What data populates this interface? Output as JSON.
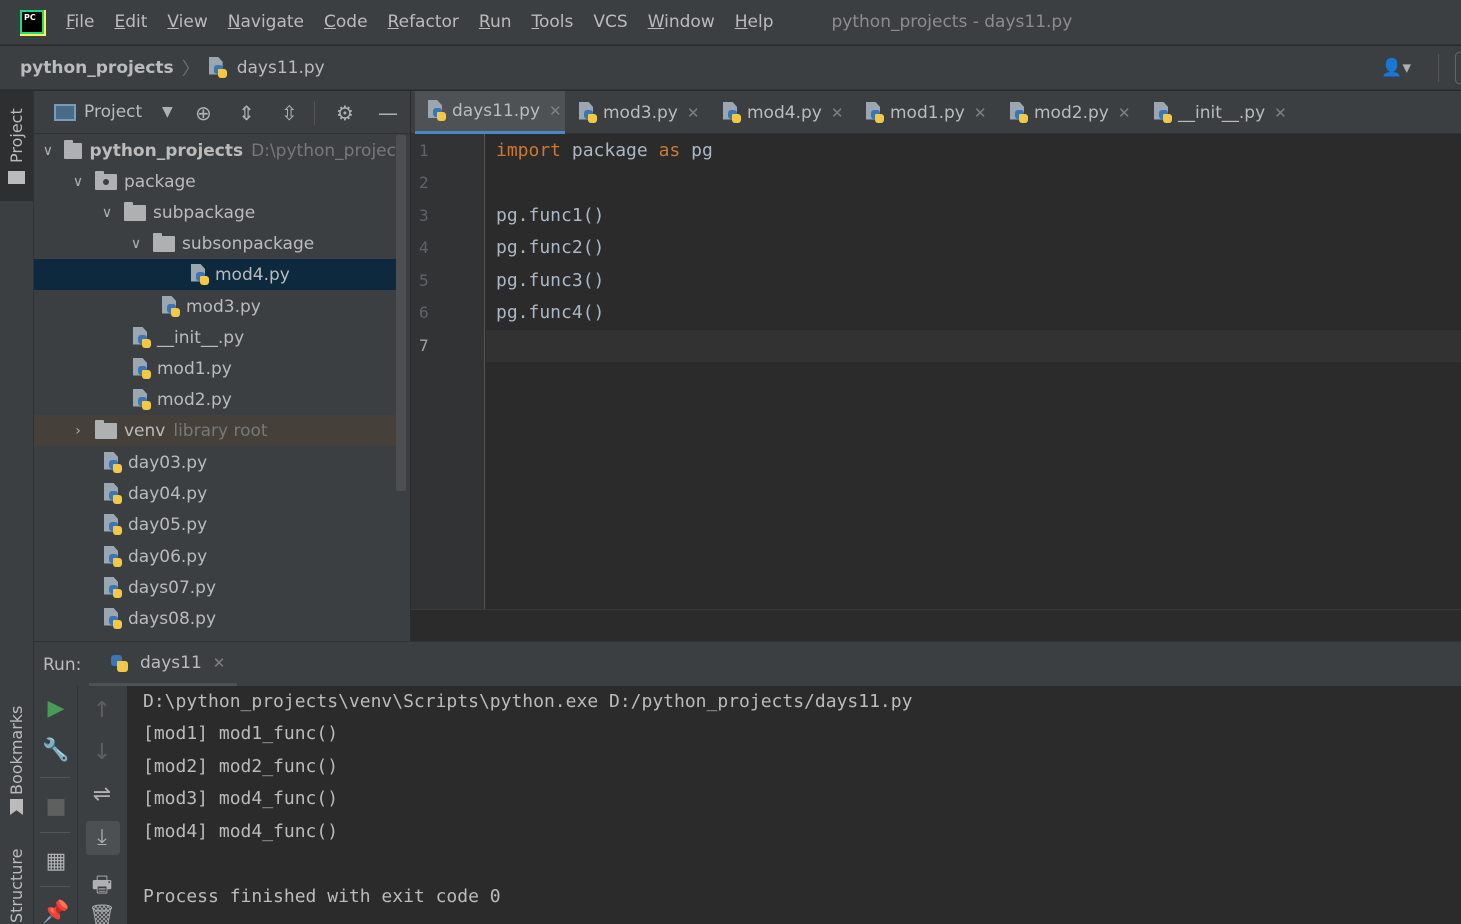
{
  "menubar": {
    "items": [
      {
        "label": "File",
        "u": "F",
        "rest": "ile"
      },
      {
        "label": "Edit",
        "u": "E",
        "rest": "dit"
      },
      {
        "label": "View",
        "u": "V",
        "rest": "iew"
      },
      {
        "label": "Navigate",
        "u": "N",
        "rest": "avigate"
      },
      {
        "label": "Code",
        "u": "C",
        "rest": "ode"
      },
      {
        "label": "Refactor",
        "u": "R",
        "rest": "efactor"
      },
      {
        "label": "Run",
        "u": "R",
        "rest": "un"
      },
      {
        "label": "Tools",
        "u": "T",
        "rest": "ools"
      },
      {
        "label": "VCS",
        "u": "",
        "rest": "VCS"
      },
      {
        "label": "Window",
        "u": "W",
        "rest": "indow"
      },
      {
        "label": "Help",
        "u": "H",
        "rest": "elp"
      }
    ],
    "window_title": "python_projects - days11.py",
    "logo_text": "PC"
  },
  "breadcrumb": {
    "root": "python_projects",
    "file": "days11.py"
  },
  "stripe": {
    "project": "Project",
    "bookmarks": "Bookmarks",
    "structure": "Structure"
  },
  "project_panel": {
    "title": "Project",
    "tree": [
      {
        "label": "python_projects",
        "hint": "D:\\python_projec",
        "kind": "folder",
        "expanded": true,
        "bold": true
      },
      {
        "label": "package",
        "kind": "pkg",
        "expanded": true
      },
      {
        "label": "subpackage",
        "kind": "folder",
        "expanded": true
      },
      {
        "label": "subsonpackage",
        "kind": "folder",
        "expanded": true
      },
      {
        "label": "mod4.py",
        "kind": "py",
        "selected": true
      },
      {
        "label": "mod3.py",
        "kind": "py"
      },
      {
        "label": "__init__.py",
        "kind": "py"
      },
      {
        "label": "mod1.py",
        "kind": "py"
      },
      {
        "label": "mod2.py",
        "kind": "py"
      },
      {
        "label": "venv",
        "hint": "library root",
        "kind": "folder",
        "expanded": false
      },
      {
        "label": "day03.py",
        "kind": "py"
      },
      {
        "label": "day04.py",
        "kind": "py"
      },
      {
        "label": "day05.py",
        "kind": "py"
      },
      {
        "label": "day06.py",
        "kind": "py"
      },
      {
        "label": "days07.py",
        "kind": "py"
      },
      {
        "label": "days08.py",
        "kind": "py"
      }
    ]
  },
  "editor": {
    "tabs": [
      {
        "label": "days11.py",
        "active": true
      },
      {
        "label": "mod3.py"
      },
      {
        "label": "mod4.py"
      },
      {
        "label": "mod1.py"
      },
      {
        "label": "mod2.py"
      },
      {
        "label": "__init__.py"
      }
    ],
    "line_numbers": [
      "1",
      "2",
      "3",
      "4",
      "5",
      "6",
      "7"
    ],
    "current_line": 7,
    "code": {
      "l1_kw1": "import",
      "l1_mid": " package ",
      "l1_kw2": "as",
      "l1_end": " pg",
      "l3": "pg.func1()",
      "l4": "pg.func2()",
      "l5": "pg.func3()",
      "l6": "pg.func4()"
    }
  },
  "run": {
    "label": "Run:",
    "tab": "days11",
    "output": [
      "D:\\python_projects\\venv\\Scripts\\python.exe D:/python_projects/days11.py",
      "[mod1] mod1_func()",
      "[mod2] mod2_func()",
      "[mod3] mod4_func()",
      "[mod4] mod4_func()",
      "",
      "Process finished with exit code 0"
    ]
  },
  "colors": {
    "keyword": "#cc7832",
    "code": "#a9b7c6",
    "selection": "#0d293e",
    "accent": "#4a88c7"
  }
}
